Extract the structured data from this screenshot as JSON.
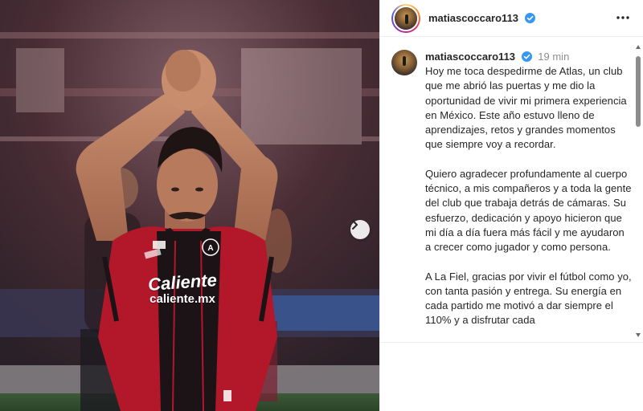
{
  "post": {
    "username": "matiascoccaro113",
    "verified": true
  },
  "caption": {
    "username": "matiascoccaro113",
    "time": "19 min",
    "paragraphs": [
      "Hoy me toca despedirme de Atlas, un club que me abrió las puertas y me dio la oportunidad de vivir mi primera experiencia en México. Este año estuvo lleno de aprendizajes, retos y grandes momentos que siempre voy a recordar.",
      "Quiero agradecer profundamente al cuerpo técnico, a mis compañeros y a toda la gente del club que trabaja detrás de cámaras. Su esfuerzo, dedicación y apoyo hicieron que mi día a día fuera más fácil y me ayudaron a crecer como jugador y como persona.",
      "A La Fiel, gracias por vivir el fútbol como yo, con tanta pasión y entrega. Su energía en cada partido me motivó a dar siempre el 110% y a disfrutar cada"
    ]
  },
  "photo": {
    "shirt_sponsor_line1": "Caliente",
    "shirt_sponsor_line2": "caliente.mx"
  },
  "icons": {
    "more": "more-options-icon",
    "next": "chevron-right-icon",
    "verified": "verified-badge-icon"
  },
  "colors": {
    "verified": "#3897f0",
    "jersey_red": "#b3172a",
    "jersey_black": "#1b1316",
    "text": "#262626",
    "muted": "#8e8e8e"
  }
}
